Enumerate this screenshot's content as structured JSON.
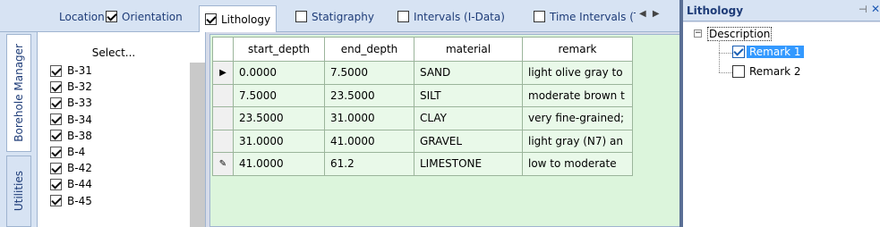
{
  "tabs": [
    {
      "label": "Location",
      "checkbox": false,
      "checked": false,
      "active": false
    },
    {
      "label": "Orientation",
      "checkbox": true,
      "checked": true,
      "active": false
    },
    {
      "label": "Lithology",
      "checkbox": true,
      "checked": true,
      "active": true
    },
    {
      "label": "Statigraphy",
      "checkbox": true,
      "checked": false,
      "active": false
    },
    {
      "label": "Intervals (I-Data)",
      "checkbox": true,
      "checked": false,
      "active": false
    },
    {
      "label": "Time Intervals (T",
      "checkbox": true,
      "checked": false,
      "active": false
    }
  ],
  "side_tabs": [
    {
      "label": "Borehole Manager",
      "active": true
    },
    {
      "label": "Utilities",
      "active": false
    }
  ],
  "list_panel": {
    "select_label": "Select...",
    "boreholes": [
      {
        "label": "B-31",
        "checked": true
      },
      {
        "label": "B-32",
        "checked": true
      },
      {
        "label": "B-33",
        "checked": true
      },
      {
        "label": "B-34",
        "checked": true
      },
      {
        "label": "B-38",
        "checked": true
      },
      {
        "label": "B-4",
        "checked": true
      },
      {
        "label": "B-42",
        "checked": true
      },
      {
        "label": "B-44",
        "checked": true
      },
      {
        "label": "B-45",
        "checked": true
      }
    ]
  },
  "grid": {
    "columns": [
      "start_depth",
      "end_depth",
      "material",
      "remark"
    ],
    "rows": [
      {
        "indicator": "current",
        "cells": [
          "0.0000",
          "7.5000",
          "SAND",
          "light olive gray to"
        ]
      },
      {
        "indicator": "",
        "cells": [
          "7.5000",
          "23.5000",
          "SILT",
          "moderate brown t"
        ]
      },
      {
        "indicator": "",
        "cells": [
          "23.5000",
          "31.0000",
          "CLAY",
          "very fine-grained;"
        ]
      },
      {
        "indicator": "",
        "cells": [
          "31.0000",
          "41.0000",
          "GRAVEL",
          "light gray (N7) an"
        ]
      },
      {
        "indicator": "editing",
        "cells": [
          "41.0000",
          "61.2",
          "LIMESTONE",
          "low to moderate"
        ]
      }
    ]
  },
  "right_panel": {
    "title": "Lithology",
    "pin_icon": "pin-icon",
    "close_icon": "close-icon",
    "tree": {
      "root_label": "Description",
      "items": [
        {
          "label": "Remark 1",
          "checked": true,
          "selected": true
        },
        {
          "label": "Remark 2",
          "checked": false,
          "selected": false
        }
      ]
    }
  },
  "icons": {
    "current_row": "▶",
    "editing_row": "✎",
    "tab_prev": "◀",
    "tab_next": "▶",
    "pin": "⊣",
    "close": "✕",
    "expander": "−"
  }
}
